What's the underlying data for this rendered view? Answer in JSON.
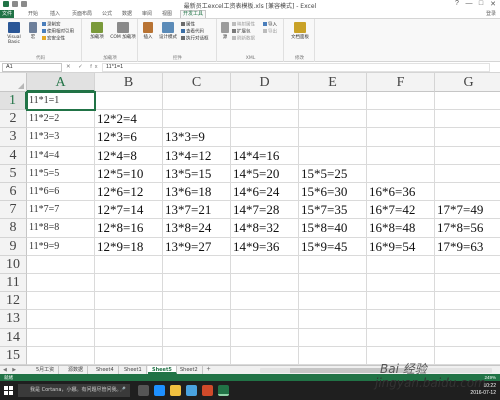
{
  "window": {
    "title": "最新员工excel工资表模板.xls [兼容模式] - Excel",
    "controls": [
      "?",
      "—",
      "□",
      "✕"
    ]
  },
  "ribbon_tabs": [
    {
      "label": "文件",
      "kind": "file"
    },
    {
      "label": "开始",
      "kind": "normal"
    },
    {
      "label": "插入",
      "kind": "normal"
    },
    {
      "label": "页面布局",
      "kind": "normal"
    },
    {
      "label": "公式",
      "kind": "normal"
    },
    {
      "label": "数据",
      "kind": "normal"
    },
    {
      "label": "审阅",
      "kind": "normal"
    },
    {
      "label": "视图",
      "kind": "normal"
    },
    {
      "label": "开发工具",
      "kind": "active"
    }
  ],
  "ribbon_right": "登录",
  "ribbon": {
    "code": {
      "visual_basic": "Visual Basic",
      "macros": "宏",
      "record_macro": "录制宏",
      "relative_ref": "使用相对引用",
      "macro_security": "宏安全性",
      "label": "代码"
    },
    "addins": {
      "addins": "加载项",
      "com_addins": "COM 加载项",
      "label": "加载项"
    },
    "controls": {
      "insert": "插入",
      "design_mode": "设计模式",
      "properties": "属性",
      "view_code": "查看代码",
      "run_dialog": "执行对话框",
      "label": "控件"
    },
    "xml": {
      "source": "源",
      "map_properties": "映射属性",
      "expansion_packs": "扩展包",
      "refresh_data": "刷新数据",
      "import": "导入",
      "export": "导出",
      "label": "XML"
    },
    "modify": {
      "doc_panel": "文档面板",
      "label": "修改"
    }
  },
  "formula_bar": {
    "name_box": "A1",
    "fx_icons": "✕ ✓ fx",
    "formula": "11*1=1"
  },
  "grid": {
    "columns": [
      "A",
      "B",
      "C",
      "D",
      "E",
      "F",
      "G"
    ],
    "selected_column": "A",
    "row_numbers": [
      "1",
      "2",
      "3",
      "4",
      "5",
      "6",
      "7",
      "8",
      "9",
      "10",
      "11",
      "12",
      "13",
      "14",
      "15"
    ],
    "selected_row": "1",
    "active_cell": "A1",
    "rows": [
      [
        "11*1=1",
        "",
        "",
        "",
        "",
        "",
        ""
      ],
      [
        "11*2=2",
        "12*2=4",
        "",
        "",
        "",
        "",
        ""
      ],
      [
        "11*3=3",
        "12*3=6",
        "13*3=9",
        "",
        "",
        "",
        ""
      ],
      [
        "11*4=4",
        "12*4=8",
        "13*4=12",
        "14*4=16",
        "",
        "",
        ""
      ],
      [
        "11*5=5",
        "12*5=10",
        "13*5=15",
        "14*5=20",
        "15*5=25",
        "",
        ""
      ],
      [
        "11*6=6",
        "12*6=12",
        "13*6=18",
        "14*6=24",
        "15*6=30",
        "16*6=36",
        ""
      ],
      [
        "11*7=7",
        "12*7=14",
        "13*7=21",
        "14*7=28",
        "15*7=35",
        "16*7=42",
        "17*7=49"
      ],
      [
        "11*8=8",
        "12*8=16",
        "13*8=24",
        "14*8=32",
        "15*8=40",
        "16*8=48",
        "17*8=56"
      ],
      [
        "11*9=9",
        "12*9=18",
        "13*9=27",
        "14*9=36",
        "15*9=45",
        "16*9=54",
        "17*9=63"
      ],
      [
        "",
        "",
        "",
        "",
        "",
        "",
        ""
      ],
      [
        "",
        "",
        "",
        "",
        "",
        "",
        ""
      ],
      [
        "",
        "",
        "",
        "",
        "",
        "",
        ""
      ],
      [
        "",
        "",
        "",
        "",
        "",
        "",
        ""
      ],
      [
        "",
        "",
        "",
        "",
        "",
        "",
        ""
      ],
      [
        "",
        "",
        "",
        "",
        "",
        "",
        ""
      ]
    ]
  },
  "sheets": {
    "nav": "◀ ▶",
    "tabs": [
      "5月工资",
      "源数据",
      "Sheet4",
      "Sheet1",
      "Sheet5",
      "Sheet2"
    ],
    "active": "Sheet5",
    "add": "+"
  },
  "status": {
    "text": "就绪",
    "zoom": "249%"
  },
  "taskbar": {
    "search_placeholder": "我是 Cortana，小娜。有问题尽管问我。",
    "mic": "🎤",
    "time": "10:22",
    "date": "2016-07-12"
  },
  "watermark": {
    "top": "Bai 经验",
    "bottom": "jingyan.baidu.com"
  },
  "colors": {
    "excel_green": "#217346",
    "header_bg": "#f3f3f3",
    "gridline": "#dadada",
    "taskbar": "#1f1f1f"
  }
}
